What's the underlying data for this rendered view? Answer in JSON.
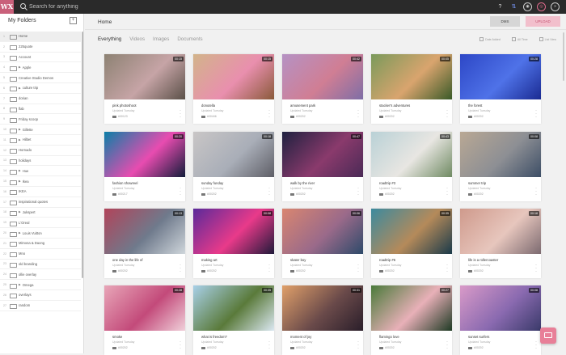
{
  "app": {
    "logo_text": "WX",
    "brand_color": "#c9607a"
  },
  "search": {
    "placeholder": "Search for anything"
  },
  "top_icons": [
    "help-icon",
    "sync-icon",
    "people-icon",
    "account-icon",
    "expand-icon"
  ],
  "top_icon_glyphs": [
    "?",
    "⇅",
    "◉",
    "◎",
    "»"
  ],
  "sidebar": {
    "title": "My Folders",
    "add_glyph": "+",
    "items": [
      {
        "num": "1",
        "label": "Home",
        "arrow": false,
        "active": true
      },
      {
        "num": "2",
        "label": "225quote",
        "arrow": false
      },
      {
        "num": "3",
        "label": "Account",
        "arrow": false
      },
      {
        "num": "4",
        "label": "Apple",
        "arrow": true
      },
      {
        "num": "5",
        "label": "Creative Studio Demos",
        "arrow": false
      },
      {
        "num": "6",
        "label": "culture trip",
        "arrow": true
      },
      {
        "num": "7",
        "label": "dorian",
        "arrow": false
      },
      {
        "num": "8",
        "label": "flab",
        "arrow": false
      },
      {
        "num": "9",
        "label": "Friday scoop",
        "arrow": false
      },
      {
        "num": "10",
        "label": "Gillette",
        "arrow": true
      },
      {
        "num": "11",
        "label": "Hilbet",
        "arrow": true
      },
      {
        "num": "12",
        "label": "Hornado",
        "arrow": false
      },
      {
        "num": "13",
        "label": "holidays",
        "arrow": false
      },
      {
        "num": "14",
        "label": "Hue",
        "arrow": true
      },
      {
        "num": "15",
        "label": "Ikea",
        "arrow": true
      },
      {
        "num": "16",
        "label": "IKEA",
        "arrow": false
      },
      {
        "num": "17",
        "label": "inspirational quotes",
        "arrow": false
      },
      {
        "num": "18",
        "label": "Jukspert",
        "arrow": true
      },
      {
        "num": "19",
        "label": "L'Oreal",
        "arrow": false
      },
      {
        "num": "20",
        "label": "Louis Vuitton",
        "arrow": true
      },
      {
        "num": "21",
        "label": "Mimosa & Daong",
        "arrow": false
      },
      {
        "num": "22",
        "label": "Mno",
        "arrow": false
      },
      {
        "num": "23",
        "label": "old branding",
        "arrow": false
      },
      {
        "num": "24",
        "label": "ollie overlay",
        "arrow": false
      },
      {
        "num": "25",
        "label": "Omega",
        "arrow": true
      },
      {
        "num": "26",
        "label": "overlays",
        "arrow": false
      },
      {
        "num": "27",
        "label": "random",
        "arrow": false
      }
    ]
  },
  "header": {
    "title": "Home",
    "dms_label": "DMS",
    "upload_label": "UPLOAD",
    "tabs": [
      "Everything",
      "Videos",
      "Images",
      "Documents"
    ],
    "tools": [
      "Date Added",
      "All Time",
      "List View"
    ]
  },
  "cards": [
    {
      "title": "pink photoshoot",
      "updated": "Updated Tuesday",
      "id": "#00123",
      "duration": "00:15",
      "colors": [
        "#8d8273",
        "#c6a4a6",
        "#5b5048"
      ]
    },
    {
      "title": "donutella",
      "updated": "Updated Tuesday",
      "id": "#00446",
      "duration": "00:15",
      "colors": [
        "#d2b48a",
        "#e98fae",
        "#8a5a3a"
      ]
    },
    {
      "title": "amusement park",
      "updated": "Updated Tuesday",
      "id": "#00202",
      "duration": "00:42",
      "colors": [
        "#b592c4",
        "#d07e94",
        "#7e6ea6"
      ]
    },
    {
      "title": "stacker's adventures",
      "updated": "Updated Tuesday",
      "id": "#00202",
      "duration": "00:05",
      "colors": [
        "#7a9a5b",
        "#d9a46e",
        "#3a5a28"
      ]
    },
    {
      "title": "the forest",
      "updated": "Updated Tuesday",
      "id": "#00202",
      "duration": "00:28",
      "colors": [
        "#2d47c6",
        "#4f72e8",
        "#1a2b92"
      ]
    },
    {
      "title": "fashion showreel",
      "updated": "Updated Tuesday",
      "id": "#00217",
      "duration": "00:20",
      "colors": [
        "#0b7fa7",
        "#e84cb0",
        "#111c3a"
      ]
    },
    {
      "title": "sunday funday",
      "updated": "Updated Tuesday",
      "id": "#00202",
      "duration": "00:18",
      "colors": [
        "#c9c6c6",
        "#a9aeb8",
        "#5e5e66"
      ]
    },
    {
      "title": "walk by the river",
      "updated": "Updated Tuesday",
      "id": "#00202",
      "duration": "00:47",
      "colors": [
        "#1f2140",
        "#8a3a6c",
        "#4a2a56"
      ]
    },
    {
      "title": "roadtrip #3",
      "updated": "Updated Tuesday",
      "id": "#00202",
      "duration": "00:43",
      "colors": [
        "#b9d1d6",
        "#e8e6e2",
        "#6f8a62"
      ]
    },
    {
      "title": "summer trip",
      "updated": "Updated Tuesday",
      "id": "#00202",
      "duration": "00:08",
      "colors": [
        "#b9a894",
        "#8d8f94",
        "#3d4e66"
      ]
    },
    {
      "title": "one day in the life of",
      "updated": "Updated Tuesday",
      "id": "#00202",
      "duration": "00:13",
      "colors": [
        "#b1445a",
        "#6f7a8c",
        "#cfd6db"
      ]
    },
    {
      "title": "making art",
      "updated": "Updated Tuesday",
      "id": "#00202",
      "duration": "00:08",
      "colors": [
        "#5a2a9a",
        "#e93a8a",
        "#1f1a3a"
      ]
    },
    {
      "title": "skater boy",
      "updated": "Updated Tuesday",
      "id": "#00202",
      "duration": "00:06",
      "colors": [
        "#d98670",
        "#9a6a8a",
        "#2e4a6a"
      ]
    },
    {
      "title": "roadtrip #6",
      "updated": "Updated Tuesday",
      "id": "#00202",
      "duration": "00:35",
      "colors": [
        "#3c8a9e",
        "#b58a5a",
        "#1a3a4a"
      ]
    },
    {
      "title": "life is a rollercoaster",
      "updated": "Updated Tuesday",
      "id": "#00202",
      "duration": "00:18",
      "colors": [
        "#cf9a8c",
        "#e7c6bd",
        "#7c6a70"
      ]
    },
    {
      "title": "smoke",
      "updated": "Updated Tuesday",
      "id": "#00202",
      "duration": "00:28",
      "colors": [
        "#e8a6b8",
        "#c34a7a",
        "#f0d0da"
      ]
    },
    {
      "title": "what is freedom?",
      "updated": "Updated Tuesday",
      "id": "#00202",
      "duration": "00:35",
      "colors": [
        "#a8d0e8",
        "#5a7a3a",
        "#dbe8f2"
      ]
    },
    {
      "title": "moment of joy",
      "updated": "Updated Tuesday",
      "id": "#00202",
      "duration": "00:31",
      "colors": [
        "#e0a06a",
        "#6a4a4a",
        "#2a1e2a"
      ]
    },
    {
      "title": "flamingo love",
      "updated": "Updated Tuesday",
      "id": "#00202",
      "duration": "00:27",
      "colors": [
        "#4a7a3a",
        "#e8b0b8",
        "#1e3a24"
      ]
    },
    {
      "title": "sunset surfers",
      "updated": "Updated Tuesday",
      "id": "#00202",
      "duration": "00:08",
      "colors": [
        "#d99ac8",
        "#8a6ab0",
        "#3a3a6a"
      ]
    }
  ]
}
